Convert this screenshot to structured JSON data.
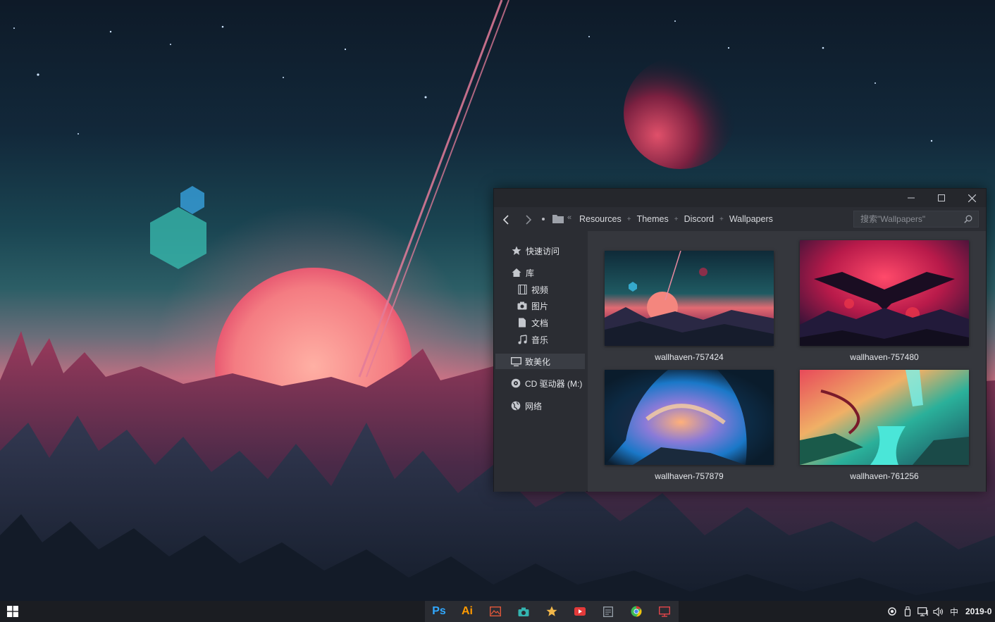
{
  "window": {
    "controls": {
      "minimize": "minimize-icon",
      "maximize": "maximize-icon",
      "close": "close-icon"
    }
  },
  "navigation": {
    "more_label": "«",
    "breadcrumb": [
      "Resources",
      "Themes",
      "Discord",
      "Wallpapers"
    ],
    "search_placeholder": "搜索\"Wallpapers\""
  },
  "sidebar": {
    "quick_access": "快速访问",
    "library": "库",
    "videos": "视频",
    "pictures": "图片",
    "documents": "文档",
    "music": "音乐",
    "this_pc": "致美化",
    "cd_drive": "CD 驱动器 (M:)",
    "network": "网络"
  },
  "files": [
    {
      "name": "wallhaven-757424",
      "palette": [
        "#1a3a45",
        "#e25a62",
        "#2a2f4a"
      ]
    },
    {
      "name": "wallhaven-757480",
      "palette": [
        "#c81e4e",
        "#3a1040",
        "#1a1630"
      ]
    },
    {
      "name": "wallhaven-757879",
      "palette": [
        "#1a82c8",
        "#f2a070",
        "#0e2a40"
      ]
    },
    {
      "name": "wallhaven-761256",
      "palette": [
        "#2aa88a",
        "#f0c26a",
        "#4ae6d0"
      ]
    }
  ],
  "taskbar": {
    "apps": [
      {
        "label": "Ps",
        "name": "photoshop-icon",
        "color": "#31a8ff"
      },
      {
        "label": "Ai",
        "name": "illustrator-icon",
        "color": "#ff9a00"
      },
      {
        "label": "",
        "name": "picture-viewer-icon",
        "color": "#e0573a"
      },
      {
        "label": "",
        "name": "camera-icon",
        "color": "#34b4b0"
      },
      {
        "label": "",
        "name": "star-icon",
        "color": "#f2b74a"
      },
      {
        "label": "",
        "name": "video-player-icon",
        "color": "#e33a3a"
      },
      {
        "label": "",
        "name": "notepad-icon",
        "color": "#9aa3ad"
      },
      {
        "label": "",
        "name": "chrome-icon",
        "color": "#3cba54"
      },
      {
        "label": "",
        "name": "monitor-icon",
        "color": "#e2454a"
      }
    ],
    "ime": "中",
    "clock": "2019-0"
  }
}
